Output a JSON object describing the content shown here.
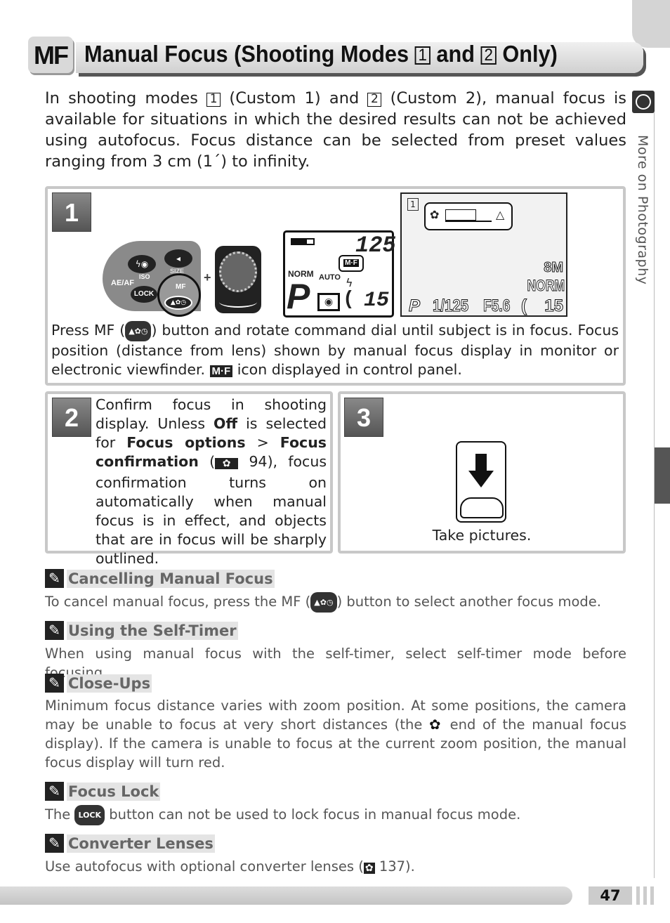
{
  "header": {
    "badge": "MF",
    "title_pre": "Manual Focus (Shooting Modes ",
    "mode1": "1",
    "title_mid": " and ",
    "mode2": "2",
    "title_post": " Only)"
  },
  "intro": {
    "t1": "In shooting modes ",
    "m1": "1",
    "t2": " (Custom 1) and ",
    "m2": "2",
    "t3": " (Custom 2), manual focus is available for situations in which the desired results can not be achieved using autofocus.  Focus distance can be selected from preset values ranging from 3 cm (1´) to infinity."
  },
  "sidebar": {
    "section": "More on Photography"
  },
  "step1": {
    "number": "1",
    "t1": "Press MF (",
    "t2": ") button and rotate command dial until subject is in focus.  Focus position (distance from lens) shown by manual focus display in monitor or electronic viewfinder. ",
    "mf_icon": "M·F",
    "t3": " icon displayed in control panel.",
    "buttons": {
      "aeaf": "AE/AF",
      "iso": "ISO",
      "size": "SIZE",
      "lock": "LOCK",
      "mf": "MF",
      "plus": "+"
    },
    "panel": {
      "shutter": "125",
      "mf": "M·F",
      "norm": "NORM",
      "auto": "AUTO",
      "mode": "P",
      "frames": "15"
    },
    "monitor": {
      "mode_icon": "1",
      "size": "8M",
      "quality": "NORM",
      "mode": "P",
      "shutter": "1/125",
      "aperture": "F5.6",
      "frames": "15"
    }
  },
  "step2": {
    "number": "2",
    "t1": "Confirm focus in shooting display.  Unless ",
    "b1": "Off",
    "t2": " is selected for ",
    "b2": "Focus options",
    "t3": " > ",
    "b3": "Focus confirmation",
    "t4": " (",
    "ref": "94",
    "t5": "), focus confirmation turns on automatically when manual focus is in effect, and objects that are in focus will be sharply outlined."
  },
  "step3": {
    "number": "3",
    "text": "Take pictures."
  },
  "notes": [
    {
      "title": "Cancelling Manual Focus",
      "t1": "To cancel manual focus, press the MF (",
      "t2": ") button to select another focus mode."
    },
    {
      "title": "Using the Self-Timer",
      "t1": "When using manual focus with the self-timer, select self-timer mode before focusing."
    },
    {
      "title": "Close-Ups",
      "t1": "Minimum focus distance varies with zoom position.  At some positions, the camera may be unable to focus at very short distances (the ",
      "t2": " end of the manual focus display).  If the camera is unable to focus at the current zoom position, the manual focus display will turn red."
    },
    {
      "title": "Focus Lock",
      "t1": "The ",
      "pill": "LOCK",
      "t2": " button can not be used to lock focus in manual focus mode."
    },
    {
      "title": "Converter Lenses",
      "t1": "Use autofocus with optional converter lenses (",
      "ref": "137",
      "t2": ")."
    }
  ],
  "footer": {
    "page": "47"
  }
}
